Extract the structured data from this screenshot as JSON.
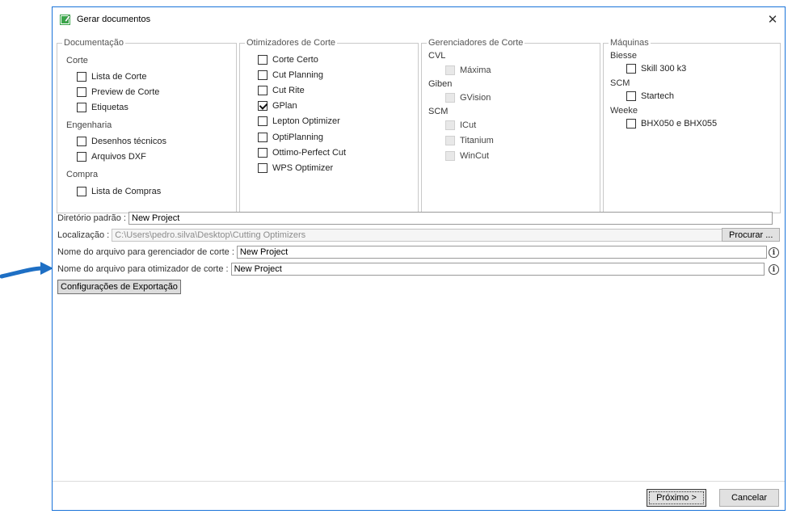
{
  "window": {
    "title": "Gerar documentos",
    "close_label": "✕"
  },
  "documentacao": {
    "legend": "Documentação",
    "sections": [
      {
        "label": "Corte",
        "items": [
          "Lista de Corte",
          "Preview de Corte",
          "Etiquetas"
        ]
      },
      {
        "label": "Engenharia",
        "items": [
          "Desenhos técnicos",
          "Arquivos DXF"
        ]
      },
      {
        "label": "Compra",
        "items": [
          "Lista de Compras"
        ]
      }
    ]
  },
  "otimizadores": {
    "legend": "Otimizadores de Corte",
    "items": [
      {
        "label": "Corte Certo",
        "checked": false
      },
      {
        "label": "Cut Planning",
        "checked": false
      },
      {
        "label": "Cut Rite",
        "checked": false
      },
      {
        "label": "GPlan",
        "checked": true
      },
      {
        "label": "Lepton Optimizer",
        "checked": false
      },
      {
        "label": "OptiPlanning",
        "checked": false
      },
      {
        "label": "Ottimo-Perfect Cut",
        "checked": false
      },
      {
        "label": "WPS Optimizer",
        "checked": false
      }
    ]
  },
  "gerenciadores": {
    "legend": "Gerenciadores de Corte",
    "sections": [
      {
        "label": "CVL",
        "items": [
          "Máxima"
        ]
      },
      {
        "label": "Giben",
        "items": [
          "GVision"
        ]
      },
      {
        "label": "SCM",
        "items": [
          "ICut",
          "Titanium",
          "WinCut"
        ]
      }
    ]
  },
  "maquinas": {
    "legend": "Máquinas",
    "sections": [
      {
        "label": "Biesse",
        "items": [
          "Skill 300 k3"
        ]
      },
      {
        "label": "SCM",
        "items": [
          "Startech"
        ]
      },
      {
        "label": "Weeke",
        "items": [
          "BHX050 e BHX055"
        ]
      }
    ]
  },
  "fields": {
    "diretorio_label": "Diretório padrão :",
    "diretorio_value": "New Project",
    "localizacao_label": "Localização :",
    "localizacao_value": "C:\\Users\\pedro.silva\\Desktop\\Cutting Optimizers",
    "procurar_label": "Procurar ...",
    "gerenciador_label": "Nome do arquivo para gerenciador de corte :",
    "gerenciador_value": "New Project",
    "otimizador_label": "Nome do arquivo para otimizador de corte :",
    "otimizador_value": "New Project",
    "info_symbol": "i"
  },
  "export_button": "Configurações de Exportação",
  "footer": {
    "next_label": "Próximo >",
    "cancel_label": "Cancelar"
  },
  "colors": {
    "window_border": "#1a73d9",
    "arrow": "#1e6fc4",
    "icon_green": "#3aa64a"
  }
}
